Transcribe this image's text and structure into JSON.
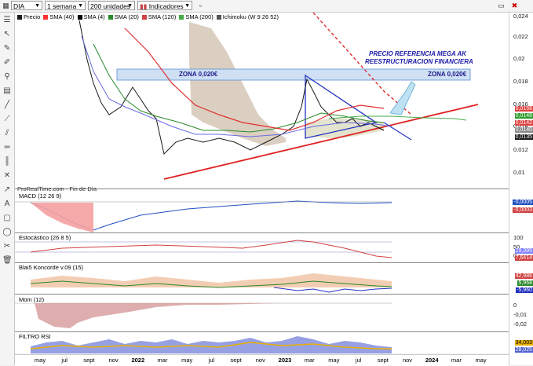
{
  "toolbar": {
    "symbol": "DIA",
    "period": "1 semana",
    "units": "200 unidades",
    "indicators": "Indicadores"
  },
  "legend": [
    {
      "label": "Precio",
      "color": "#1a1a1a"
    },
    {
      "label": "SMA (40)",
      "color": "#ff3333"
    },
    {
      "label": "SMA (4)",
      "color": "#000000"
    },
    {
      "label": "SMA (20)",
      "color": "#2a8a2a"
    },
    {
      "label": "SMA (120)",
      "color": "#cc4444"
    },
    {
      "label": "SMA (200)",
      "color": "#44aa44"
    },
    {
      "label": "Ichimoku (W 9 26 52)",
      "color": "#555555"
    }
  ],
  "price_axis": [
    "0,024",
    "0,022",
    "0,02",
    "0,018",
    "0,016",
    "0,014",
    "0,012",
    "0,01"
  ],
  "price_tags": [
    {
      "text": "0,0156",
      "color": "#e04040"
    },
    {
      "text": "0,0148",
      "color": "#2a9a2a"
    },
    {
      "text": "0,0142",
      "color": "#e04040"
    },
    {
      "text": "0,0140",
      "color": "#888888"
    },
    {
      "text": "0,0135",
      "color": "#1a1a1a"
    }
  ],
  "annotations": {
    "mega_ak": "PRECIO REFERENCIA MEGA AK",
    "restructuring": "REESTRUCTURACION FINANCIERA",
    "zone_left": "ZONA 0,020€",
    "zone_right": "ZONA 0,020€",
    "source": "ProRealTime.com - Fin de Día"
  },
  "panels": [
    {
      "title": "MACD (12 26 9)",
      "tags": [
        "-0,0005",
        "-0,0003"
      ]
    },
    {
      "title": "Estocástico (26 8 5)",
      "axis": [
        "100",
        "50",
        "0"
      ],
      "tags": [
        "29,395",
        "7,6414"
      ]
    },
    {
      "title": "Blai5 Koncorde v.09 (15)",
      "tags": [
        "42,986",
        "5,968",
        "-5,960"
      ]
    },
    {
      "title": "Mom (12)",
      "axis": [
        "0",
        "-0,01",
        "-0,02"
      ]
    },
    {
      "title": "FILTRO RSI",
      "tags": [
        "34,003",
        "28,025"
      ]
    }
  ],
  "time_axis": [
    {
      "label": "may",
      "bold": false
    },
    {
      "label": "jul",
      "bold": false
    },
    {
      "label": "sept",
      "bold": false
    },
    {
      "label": "nov",
      "bold": false
    },
    {
      "label": "2022",
      "bold": true
    },
    {
      "label": "mar",
      "bold": false
    },
    {
      "label": "may",
      "bold": false
    },
    {
      "label": "jul",
      "bold": false
    },
    {
      "label": "sept",
      "bold": false
    },
    {
      "label": "nov",
      "bold": false
    },
    {
      "label": "2023",
      "bold": true
    },
    {
      "label": "mar",
      "bold": false
    },
    {
      "label": "may",
      "bold": false
    },
    {
      "label": "jul",
      "bold": false
    },
    {
      "label": "sept",
      "bold": false
    },
    {
      "label": "nov",
      "bold": false
    },
    {
      "label": "2024",
      "bold": true
    },
    {
      "label": "mar",
      "bold": false
    },
    {
      "label": "may",
      "bold": false
    }
  ]
}
